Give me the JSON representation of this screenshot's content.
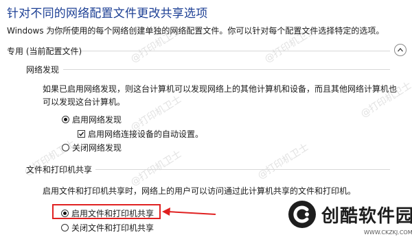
{
  "page": {
    "title": "针对不同的网络配置文件更改共享选项",
    "description": "Windows 为你所使用的每个网络创建单独的网络配置文件。你可以针对每个配置文件选择特定的选项。"
  },
  "profile": {
    "label": "专用 (当前配置文件)",
    "collapse_icon": "chevron-up-icon"
  },
  "network_discovery": {
    "heading": "网络发现",
    "description": "如果已启用网络发现，则这台计算机可以发现网络上的其他计算机和设备，而且其他网络计算机也可以发现这台计算机。",
    "options": [
      {
        "label": "启用网络发现",
        "selected": true
      },
      {
        "label": "关闭网络发现",
        "selected": false
      }
    ],
    "auto_setup": {
      "label": "启用网络连接设备的自动设置。",
      "checked": true
    }
  },
  "file_printer_sharing": {
    "heading": "文件和打印机共享",
    "description": "启用文件和打印机共享时，网络上的用户可以访问通过此计算机共享的文件和打印机。",
    "options": [
      {
        "label": "启用文件和打印机共享",
        "selected": true
      },
      {
        "label": "关闭文件和打印机共享",
        "selected": false
      }
    ]
  },
  "annotation": {
    "color": "#e02020"
  },
  "watermark": {
    "text": "@打印机卫士"
  },
  "brand": {
    "name": "创酷软件园",
    "url": "WWW.CKZKJ.COM"
  },
  "colors": {
    "title": "#1c3f94",
    "rule": "#d7d7d7"
  }
}
